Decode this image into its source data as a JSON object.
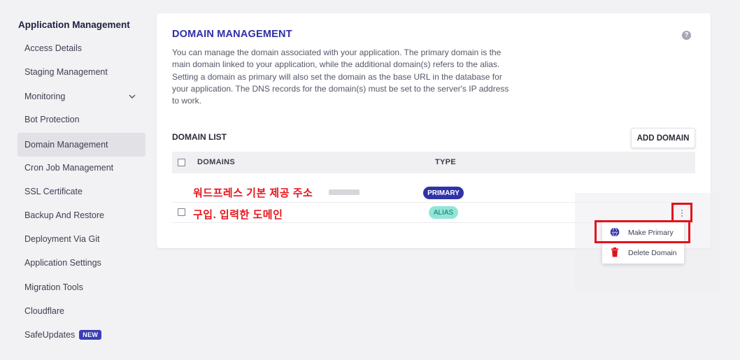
{
  "sidebar": {
    "title": "Application Management",
    "items": [
      {
        "label": "Access Details"
      },
      {
        "label": "Staging Management"
      },
      {
        "label": "Monitoring"
      },
      {
        "label": "Bot Protection"
      },
      {
        "label": "Domain Management"
      },
      {
        "label": "Cron Job Management"
      },
      {
        "label": "SSL Certificate"
      },
      {
        "label": "Backup And Restore"
      },
      {
        "label": "Deployment Via Git"
      },
      {
        "label": "Application Settings"
      },
      {
        "label": "Migration Tools"
      },
      {
        "label": "Cloudflare"
      },
      {
        "label": "SafeUpdates",
        "badge": "NEW"
      }
    ]
  },
  "card": {
    "title": "DOMAIN MANAGEMENT",
    "help_icon": "?",
    "description": "You can manage the domain associated with your application. The primary domain is the main domain linked to your application, while the additional domain(s) refers to the alias. Setting a domain as primary will also set the domain as the base URL in the database for your application. The DNS records for the domain(s) must be set to the server's IP address to work.",
    "list_title": "DOMAIN LIST",
    "add_button": "ADD DOMAIN",
    "columns": {
      "domains": "DOMAINS",
      "type": "TYPE"
    },
    "rows": [
      {
        "domain": "워드프레스 기본 제공 주소",
        "type": "PRIMARY"
      },
      {
        "domain": "구입. 입력한 도메인",
        "type": "ALIAS"
      }
    ]
  },
  "menu": {
    "items": [
      {
        "label": "Make Primary",
        "icon": "www-globe-icon"
      },
      {
        "label": "Delete Domain",
        "icon": "trash-icon"
      }
    ]
  },
  "colors": {
    "accent": "#2f33a8",
    "annotation": "#e3121b",
    "alias": "#8fe6d8"
  }
}
